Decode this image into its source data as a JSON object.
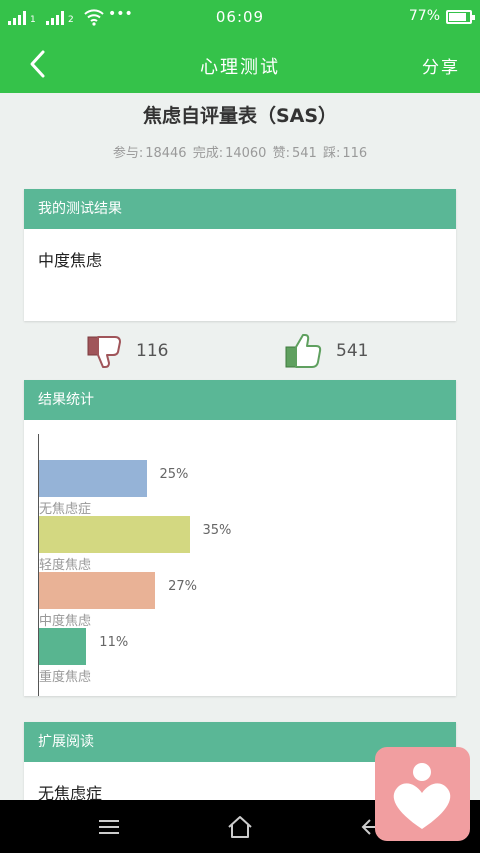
{
  "status_bar": {
    "time": "06:09",
    "battery_text": "77%",
    "dots": "•••"
  },
  "app_bar": {
    "back_icon": "chevron-left-icon",
    "title": "心理测试",
    "share_label": "分享"
  },
  "test": {
    "title": "焦虑自评量表（SAS）",
    "participate_label": "参与:",
    "participate_count": "18446",
    "complete_label": "完成:",
    "complete_count": "14060",
    "like_label": "赞:",
    "like_count": "541",
    "dislike_label": "踩:",
    "dislike_count": "116"
  },
  "result_card": {
    "header": "我的测试结果",
    "result": "中度焦虑"
  },
  "votes": {
    "dislike_count": "116",
    "like_count": "541"
  },
  "stats_card": {
    "header": "结果统计"
  },
  "chart_data": {
    "type": "bar",
    "orientation": "horizontal",
    "categories": [
      "无焦虑症",
      "轻度焦虑",
      "中度焦虑",
      "重度焦虑"
    ],
    "values": [
      25,
      35,
      27,
      11
    ],
    "value_labels": [
      "25%",
      "35%",
      "27%",
      "11%"
    ],
    "colors": [
      "#95b3d7",
      "#d3d881",
      "#e9b296",
      "#58b590"
    ],
    "xlim": [
      0,
      100
    ]
  },
  "reading_card": {
    "header": "扩展阅读",
    "first_item": "无焦虑症"
  },
  "nav_bar": {
    "menu_icon": "menu-icon",
    "home_icon": "home-icon",
    "back_icon": "back-arrow-icon"
  },
  "fab": {
    "icon": "heart-person-icon",
    "color": "#f19ea0"
  }
}
